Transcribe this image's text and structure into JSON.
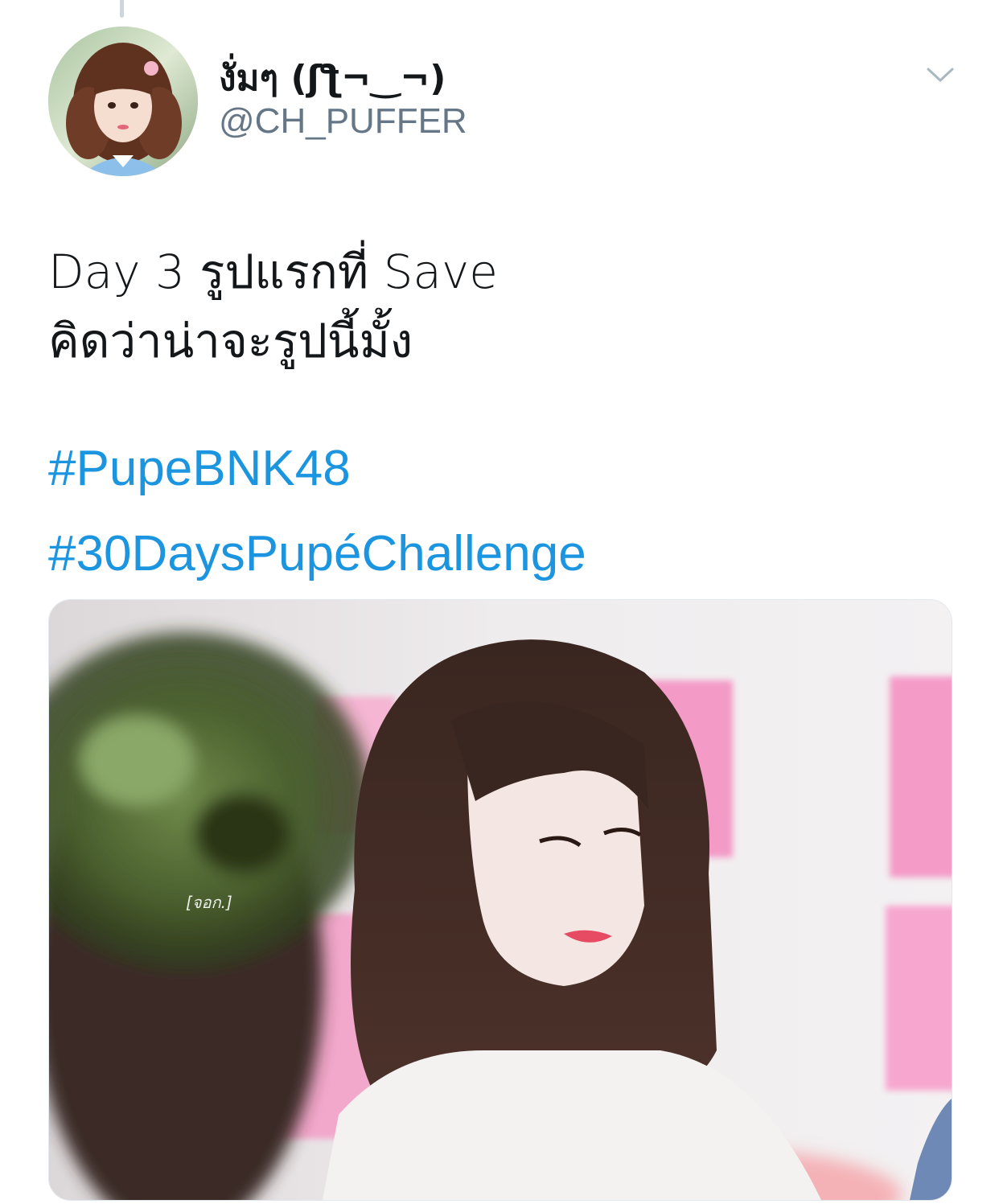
{
  "tweet": {
    "author": {
      "display_name": "งั่มๆ (ʃƪ¬‿¬)",
      "handle": "@CH_PUFFER"
    },
    "text_lines": [
      "Day 3 รูปแรกที่ Save",
      "คิดว่าน่าจะรูปนี้มั้ง"
    ],
    "hashtags": [
      "#PupeBNK48",
      "#30DaysPupéChallenge"
    ],
    "media": {
      "watermark": "[จอก.]"
    }
  },
  "colors": {
    "link": "#1b95e0",
    "secondary_text": "#657786",
    "primary_text": "#14171a",
    "thread_line": "#ccd6dd"
  },
  "icons": {
    "menu": "chevron-down-icon"
  }
}
